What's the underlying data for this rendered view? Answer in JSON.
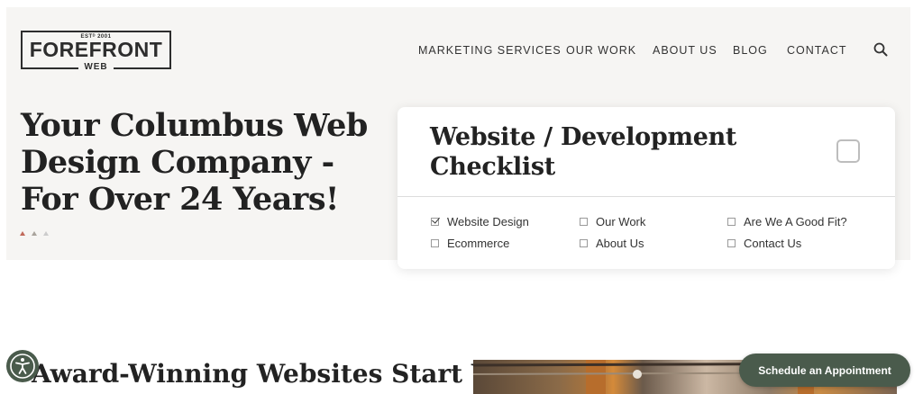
{
  "logo": {
    "est": "ESTᴰ 2001",
    "name": "FOREFRONT",
    "sub": "WEB"
  },
  "nav": {
    "items": [
      {
        "label": "MARKETING SERVICES"
      },
      {
        "label": "OUR WORK"
      },
      {
        "label": "ABOUT US"
      },
      {
        "label": "BLOG"
      },
      {
        "label": "CONTACT"
      }
    ],
    "search_icon": "search-icon"
  },
  "hero": {
    "title": "Your Columbus Web Design Company - For Over 24 Years!",
    "slider": {
      "count": 3,
      "active": 1
    }
  },
  "checklist": {
    "title": "Website / Development Checklist",
    "items": [
      {
        "label": "Website Design",
        "checked": true
      },
      {
        "label": "Our Work",
        "checked": false
      },
      {
        "label": "Are We A Good Fit?",
        "checked": false
      },
      {
        "label": "Ecommerce",
        "checked": false
      },
      {
        "label": "About Us",
        "checked": false
      },
      {
        "label": "Contact Us",
        "checked": false
      }
    ]
  },
  "section": {
    "title": "Award-Winning Websites Start With"
  },
  "accessibility": {
    "icon": "accessibility-icon"
  },
  "cta": {
    "label": "Schedule an Appointment"
  },
  "colors": {
    "accent": "#4a5b4c",
    "hero_bg": "#f6f5f3",
    "slider_active": "#c0695a"
  }
}
